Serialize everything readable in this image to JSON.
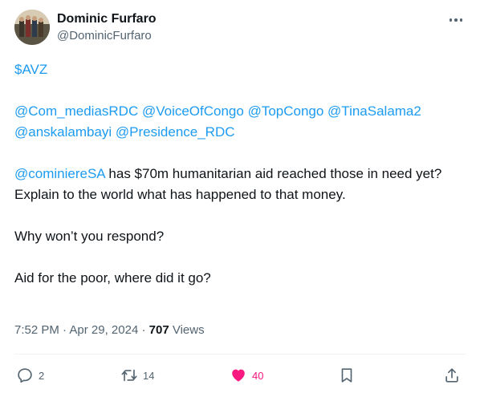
{
  "author": {
    "display_name": "Dominic Furfaro",
    "handle": "@DominicFurfaro"
  },
  "tweet": {
    "cashtag": "$AVZ",
    "mentions_line1": "@Com_mediasRDC @VoiceOfCongo @TopCongo @TinaSalama2",
    "mentions_line2": "@anskalambayi @Presidence_RDC",
    "question_mention": "@cominiereSA",
    "question_text": " has $70m humanitarian aid reached those in need yet? Explain to the world what has happened to that money.",
    "line_respond": "Why won’t you respond?",
    "line_aid": "Aid for the poor, where did it go?"
  },
  "meta": {
    "time": "7:52 PM",
    "sep1": " · ",
    "date": "Apr 29, 2024",
    "sep2": " · ",
    "views_count": "707",
    "views_label": " Views"
  },
  "actions": {
    "reply_count": "2",
    "retweet_count": "14",
    "like_count": "40"
  },
  "icons": {
    "reply": "reply-icon",
    "retweet": "retweet-icon",
    "like": "heart-icon",
    "bookmark": "bookmark-icon",
    "share": "share-icon",
    "more": "more-icon"
  },
  "colors": {
    "link": "#1d9bf0",
    "like_active": "#f91880",
    "secondary_text": "#536471",
    "primary_text": "#0f1419"
  }
}
